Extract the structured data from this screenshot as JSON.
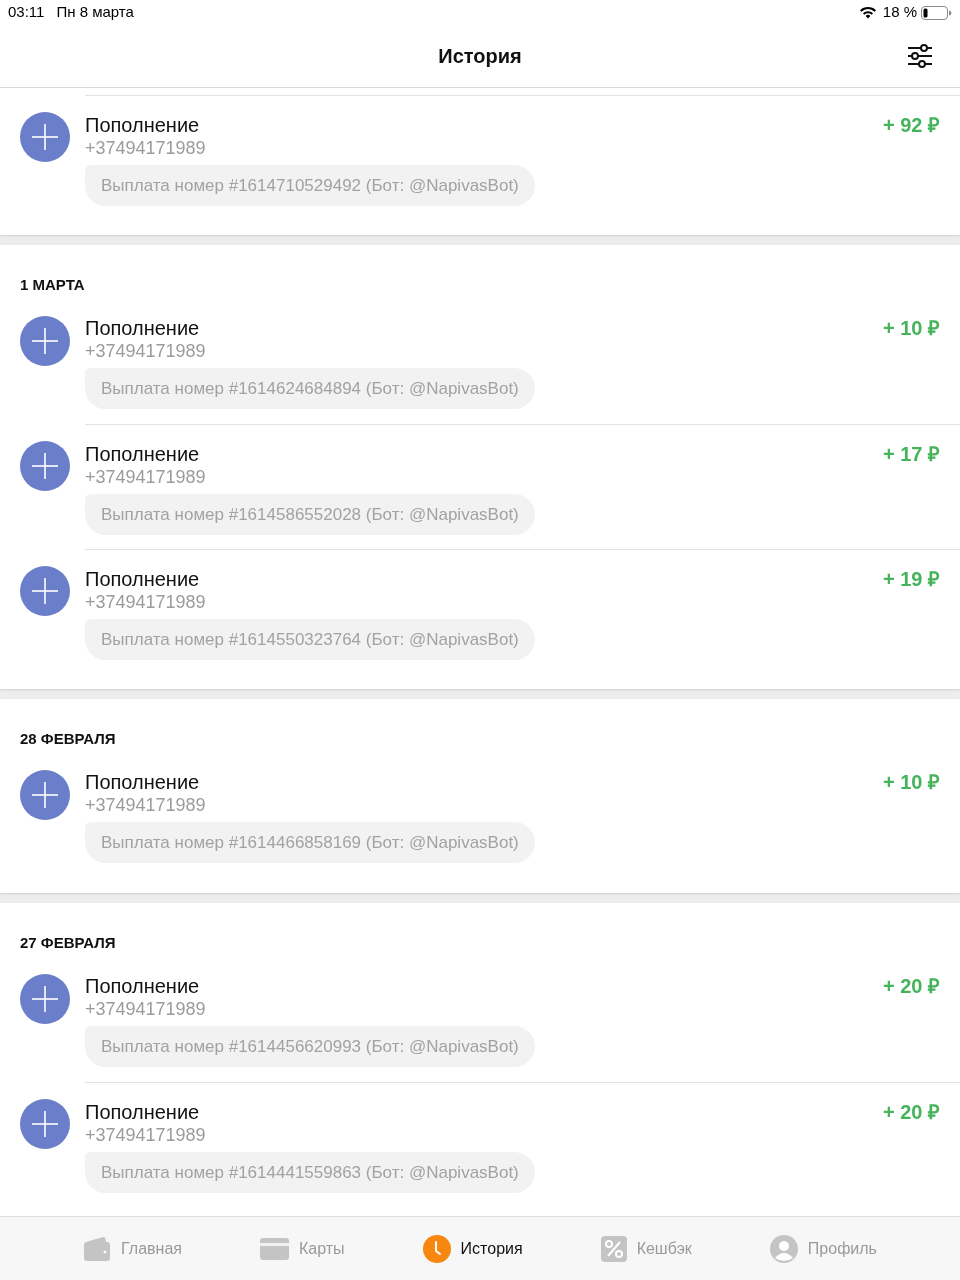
{
  "status_bar": {
    "time": "03:11",
    "date": "Пн 8 марта",
    "battery": "18 %"
  },
  "header": {
    "title": "История"
  },
  "sections": [
    {
      "rows": [
        {
          "title": "Пополнение",
          "phone": "+37494171989",
          "note": "Выплата номер #1614710529492 (Бот: @NapivasBot)",
          "amount": "+ 92 ₽"
        }
      ]
    },
    {
      "heading": "1 МАРТА",
      "rows": [
        {
          "title": "Пополнение",
          "phone": "+37494171989",
          "note": "Выплата номер #1614624684894 (Бот: @NapivasBot)",
          "amount": "+ 10 ₽"
        },
        {
          "title": "Пополнение",
          "phone": "+37494171989",
          "note": "Выплата номер #1614586552028 (Бот: @NapivasBot)",
          "amount": "+ 17 ₽"
        },
        {
          "title": "Пополнение",
          "phone": "+37494171989",
          "note": "Выплата номер #1614550323764 (Бот: @NapivasBot)",
          "amount": "+ 19 ₽"
        }
      ]
    },
    {
      "heading": "28 ФЕВРАЛЯ",
      "rows": [
        {
          "title": "Пополнение",
          "phone": "+37494171989",
          "note": "Выплата номер #1614466858169 (Бот: @NapivasBot)",
          "amount": "+ 10 ₽"
        }
      ]
    },
    {
      "heading": "27 ФЕВРАЛЯ",
      "rows": [
        {
          "title": "Пополнение",
          "phone": "+37494171989",
          "note": "Выплата номер #1614456620993 (Бот: @NapivasBot)",
          "amount": "+ 20 ₽"
        },
        {
          "title": "Пополнение",
          "phone": "+37494171989",
          "note": "Выплата номер #1614441559863 (Бот: @NapivasBot)",
          "amount": "+ 20 ₽"
        }
      ]
    }
  ],
  "tab_bar": {
    "tabs": [
      {
        "label": "Главная",
        "selected": false
      },
      {
        "label": "Карты",
        "selected": false
      },
      {
        "label": "История",
        "selected": true
      },
      {
        "label": "Кешбэк",
        "selected": false
      },
      {
        "label": "Профиль",
        "selected": false
      }
    ]
  }
}
